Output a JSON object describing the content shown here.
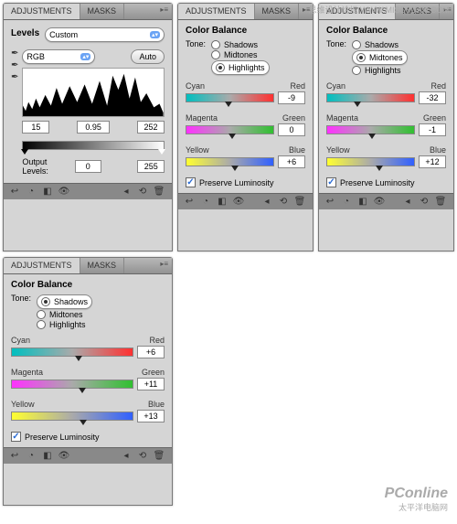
{
  "watermarks": {
    "top": "思维设计论坛 WWW.MISSYUAN.COM",
    "bottom_brand": "PConline",
    "bottom_sub": "太平洋电脑网"
  },
  "tabs": {
    "adjustments": "ADJUSTMENTS",
    "masks": "MASKS"
  },
  "levels": {
    "title": "Levels",
    "preset": "Custom",
    "channel": "RGB",
    "auto": "Auto",
    "blackpt": "15",
    "gamma": "0.95",
    "whitept": "252",
    "output_label": "Output Levels:",
    "out_black": "0",
    "out_white": "255"
  },
  "cb": {
    "title": "Color Balance",
    "tone_label": "Tone:",
    "shadows": "Shadows",
    "midtones": "Midtones",
    "highlights": "Highlights",
    "cyan": "Cyan",
    "red": "Red",
    "magenta": "Magenta",
    "green": "Green",
    "yellow": "Yellow",
    "blue": "Blue",
    "preserve": "Preserve Luminosity"
  },
  "panel1": {
    "sel": "highlights",
    "cr": "-9",
    "mg": "0",
    "yb": "+6"
  },
  "panel2": {
    "sel": "midtones",
    "cr": "-32",
    "mg": "-1",
    "yb": "+12"
  },
  "panel3": {
    "sel": "shadows",
    "cr": "+6",
    "mg": "+11",
    "yb": "+13"
  }
}
